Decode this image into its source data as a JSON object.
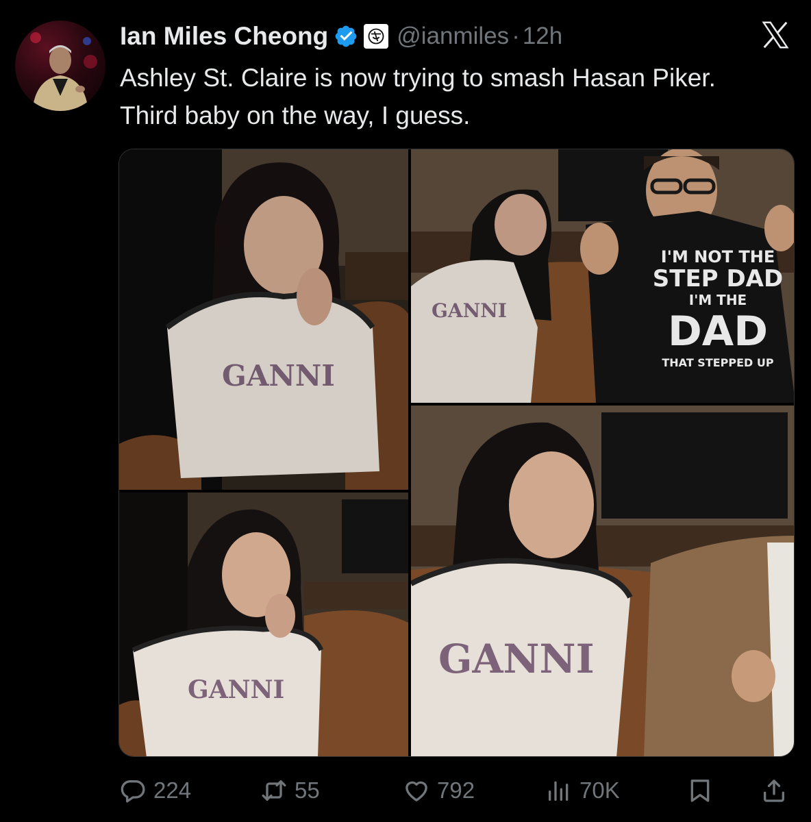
{
  "author": {
    "name": "Ian Miles Cheong",
    "handle": "@ianmiles",
    "separator": "·",
    "time": "12h",
    "verified_color": "#1d9bf0"
  },
  "tweet": {
    "text": "Ashley St. Claire is now trying to smash Hasan Piker. Third baby on the way, I guess."
  },
  "media": {
    "shirt_lines": [
      "I'M NOT THE",
      "STEP DAD",
      "I'M THE",
      "DAD",
      "THAT STEPPED UP"
    ]
  },
  "actions": {
    "replies": "224",
    "reposts": "55",
    "likes": "792",
    "views": "70K"
  },
  "icons": {
    "reply": "reply-bubble-icon",
    "repost": "repost-icon",
    "like": "heart-icon",
    "views": "bar-chart-icon",
    "bookmark": "bookmark-icon",
    "share": "share-upload-icon",
    "platform": "x-logo-icon"
  }
}
